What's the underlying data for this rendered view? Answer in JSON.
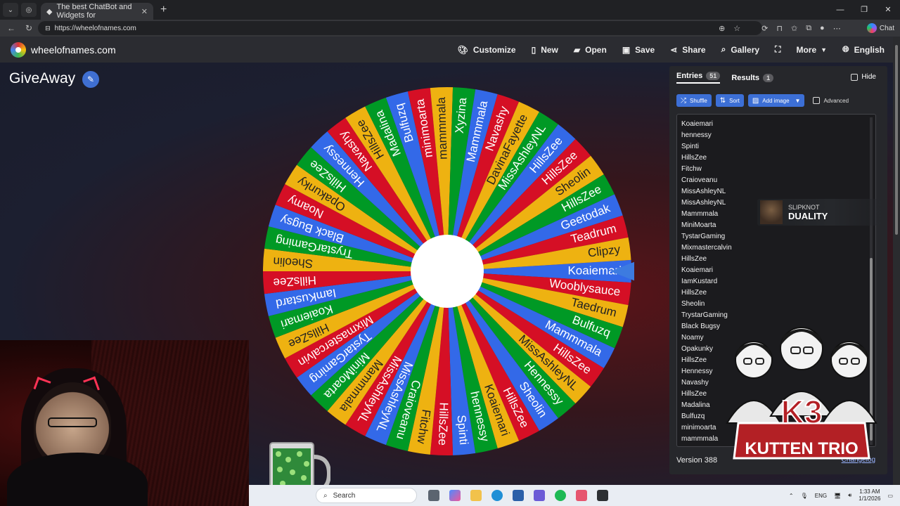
{
  "browser": {
    "tab_title": "The best ChatBot and Widgets for",
    "url": "https://wheelofnames.com",
    "chat_label": "Chat"
  },
  "app": {
    "logo_text": "wheelofnames.com",
    "menu": [
      "Customize",
      "New",
      "Open",
      "Save",
      "Share",
      "Gallery",
      "More",
      "English"
    ]
  },
  "wheel": {
    "title": "GiveAway",
    "colors": [
      "#3369e8",
      "#d50f25",
      "#eeb211",
      "#009925"
    ],
    "segments": [
      "Koaiemari",
      "Wooblysauce",
      "Taedrum",
      "Bulfuzq",
      "Mammmala",
      "HillsZee",
      "MissAshleyNL",
      "Hennessy",
      "Sheolin",
      "HillsZee",
      "Koaiemari",
      "hennessy",
      "Spinti",
      "HillsZee",
      "Fitchw",
      "Craioveanu",
      "MissAshleyNL",
      "MissAshleyNL",
      "Mammmala",
      "MiniMoarta",
      "TystarGaming",
      "Mixmastercalvin",
      "HillsZee",
      "Koaiemari",
      "IamKustard",
      "HillsZee",
      "Sheolin",
      "TrystarGaming",
      "Black Bugsy",
      "Noamy",
      "Opakunky",
      "HillsZee",
      "Hennessy",
      "Navashy",
      "HillsZee",
      "Madalina",
      "Bulfuzq",
      "minimoarta",
      "mammmala",
      "Xyzina",
      "Mammmala",
      "Navashy",
      "DavinaFayette",
      "MissAshleyNL",
      "HillsZee",
      "HillsZee",
      "Sheolin",
      "HillsZee",
      "Geetodak",
      "Teadrum",
      "Clipzy"
    ]
  },
  "panel": {
    "tabs": [
      {
        "label": "Entries",
        "count": "51"
      },
      {
        "label": "Results",
        "count": "1"
      }
    ],
    "hide_label": "Hide",
    "buttons": {
      "shuffle": "Shuffle",
      "sort": "Sort",
      "add_image": "Add image",
      "advanced": "Advanced"
    },
    "entries": [
      "Koaiemari",
      "hennessy",
      "Spinti",
      "HillsZee",
      "Fitchw",
      "Craioveanu",
      "MissAshleyNL",
      "MissAshleyNL",
      "Mammmala",
      "MiniMoarta",
      "TystarGaming",
      "Mixmastercalvin",
      "HillsZee",
      "Koaiemari",
      "IamKustard",
      "HillsZee",
      "Sheolin",
      "TrystarGaming",
      "Black Bugsy",
      "Noamy",
      "Opakunky",
      "HillsZee",
      "Hennessy",
      "Navashy",
      "HillsZee",
      "Madalina",
      "Bulfuzq",
      "minimoarta",
      "mammmala"
    ],
    "version": "Version 388",
    "changelog": "Changelog"
  },
  "now_playing": {
    "artist": "SLIPKNOT",
    "song": "DUALITY"
  },
  "overlay": {
    "brand_line1": "K3",
    "brand_line2": "KUTTEN TRIO"
  },
  "taskbar": {
    "search_placeholder": "Search",
    "lang": "ENG",
    "time": "1:33 AM",
    "date": "1/1/2026"
  }
}
